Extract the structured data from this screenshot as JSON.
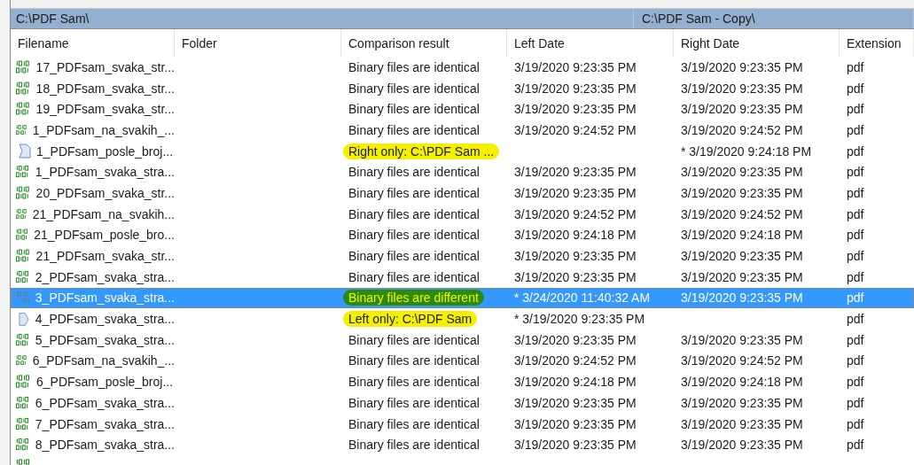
{
  "paths": {
    "left": "C:\\PDF Sam\\",
    "right": "C:\\PDF Sam - Copy\\"
  },
  "columns": [
    "Filename",
    "Folder",
    "Comparison result",
    "Left Date",
    "Right Date",
    "Extension"
  ],
  "rows": [
    {
      "kind": "identical",
      "selected": false,
      "filename": "17_PDFsam_svaka_str...",
      "result": "Binary files are identical",
      "left_date": "3/19/2020 9:23:35 PM",
      "right_date": "3/19/2020 9:23:35 PM",
      "extension": "pdf"
    },
    {
      "kind": "identical",
      "selected": false,
      "filename": "18_PDFsam_svaka_str...",
      "result": "Binary files are identical",
      "left_date": "3/19/2020 9:23:35 PM",
      "right_date": "3/19/2020 9:23:35 PM",
      "extension": "pdf"
    },
    {
      "kind": "identical",
      "selected": false,
      "filename": "19_PDFsam_svaka_str...",
      "result": "Binary files are identical",
      "left_date": "3/19/2020 9:23:35 PM",
      "right_date": "3/19/2020 9:23:35 PM",
      "extension": "pdf"
    },
    {
      "kind": "identical",
      "selected": false,
      "filename": "1_PDFsam_na_svakih_...",
      "result": "Binary files are identical",
      "left_date": "3/19/2020 9:24:52 PM",
      "right_date": "3/19/2020 9:24:52 PM",
      "extension": "pdf"
    },
    {
      "kind": "right_only",
      "selected": false,
      "filename": "1_PDFsam_posle_broj...",
      "result": "Right only: C:\\PDF Sam ...",
      "right_date": "* 3/19/2020 9:24:18 PM",
      "extension": "pdf"
    },
    {
      "kind": "identical",
      "selected": false,
      "filename": "1_PDFsam_svaka_stra...",
      "result": "Binary files are identical",
      "left_date": "3/19/2020 9:23:35 PM",
      "right_date": "3/19/2020 9:23:35 PM",
      "extension": "pdf"
    },
    {
      "kind": "identical",
      "selected": false,
      "filename": "20_PDFsam_svaka_str...",
      "result": "Binary files are identical",
      "left_date": "3/19/2020 9:23:35 PM",
      "right_date": "3/19/2020 9:23:35 PM",
      "extension": "pdf"
    },
    {
      "kind": "identical",
      "selected": false,
      "filename": "21_PDFsam_na_svakih...",
      "result": "Binary files are identical",
      "left_date": "3/19/2020 9:24:52 PM",
      "right_date": "3/19/2020 9:24:52 PM",
      "extension": "pdf"
    },
    {
      "kind": "identical",
      "selected": false,
      "filename": "21_PDFsam_posle_bro...",
      "result": "Binary files are identical",
      "left_date": "3/19/2020 9:24:18 PM",
      "right_date": "3/19/2020 9:24:18 PM",
      "extension": "pdf"
    },
    {
      "kind": "identical",
      "selected": false,
      "filename": "21_PDFsam_svaka_str...",
      "result": "Binary files are identical",
      "left_date": "3/19/2020 9:23:35 PM",
      "right_date": "3/19/2020 9:23:35 PM",
      "extension": "pdf"
    },
    {
      "kind": "identical",
      "selected": false,
      "filename": "2_PDFsam_svaka_stra...",
      "result": "Binary files are identical",
      "left_date": "3/19/2020 9:23:35 PM",
      "right_date": "3/19/2020 9:23:35 PM",
      "extension": "pdf"
    },
    {
      "kind": "different",
      "selected": true,
      "filename": "3_PDFsam_svaka_stra...",
      "result": "Binary files are different",
      "left_date": "* 3/24/2020 11:40:32 AM",
      "right_date": "3/19/2020 9:23:35 PM",
      "extension": "pdf"
    },
    {
      "kind": "left_only",
      "selected": false,
      "filename": "4_PDFsam_svaka_stra...",
      "result": "Left only: C:\\PDF Sam",
      "left_date": "* 3/19/2020 9:23:35 PM",
      "extension": "pdf"
    },
    {
      "kind": "identical",
      "selected": false,
      "filename": "5_PDFsam_svaka_stra...",
      "result": "Binary files are identical",
      "left_date": "3/19/2020 9:23:35 PM",
      "right_date": "3/19/2020 9:23:35 PM",
      "extension": "pdf"
    },
    {
      "kind": "identical",
      "selected": false,
      "filename": "6_PDFsam_na_svakih_...",
      "result": "Binary files are identical",
      "left_date": "3/19/2020 9:24:52 PM",
      "right_date": "3/19/2020 9:24:52 PM",
      "extension": "pdf"
    },
    {
      "kind": "identical",
      "selected": false,
      "filename": "6_PDFsam_posle_broj...",
      "result": "Binary files are identical",
      "left_date": "3/19/2020 9:24:18 PM",
      "right_date": "3/19/2020 9:24:18 PM",
      "extension": "pdf"
    },
    {
      "kind": "identical",
      "selected": false,
      "filename": "6_PDFsam_svaka_stra...",
      "result": "Binary files are identical",
      "left_date": "3/19/2020 9:23:35 PM",
      "right_date": "3/19/2020 9:23:35 PM",
      "extension": "pdf"
    },
    {
      "kind": "identical",
      "selected": false,
      "filename": "7_PDFsam_svaka_stra...",
      "result": "Binary files are identical",
      "left_date": "3/19/2020 9:23:35 PM",
      "right_date": "3/19/2020 9:23:35 PM",
      "extension": "pdf"
    },
    {
      "kind": "identical",
      "selected": false,
      "filename": "8_PDFsam_svaka_stra...",
      "result": "Binary files are identical",
      "left_date": "3/19/2020 9:23:35 PM",
      "right_date": "3/19/2020 9:23:35 PM",
      "extension": "pdf"
    }
  ]
}
